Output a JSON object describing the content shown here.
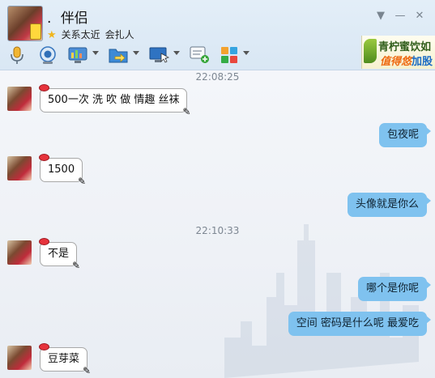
{
  "header": {
    "dot": ".",
    "nickname": "伴侣",
    "relation": "关系太近",
    "signature": "会扎人",
    "window_controls": {
      "menu": "▼",
      "minimize": "—",
      "close": "✕"
    },
    "toolbar_icons": [
      "microphone-icon",
      "video-camera-icon",
      "app-share-icon",
      "file-transfer-icon",
      "remote-screen-icon",
      "add-chat-icon",
      "apps-grid-icon"
    ],
    "ad": {
      "line1": "青柠蜜饮如",
      "line2_prefix": "值得悠",
      "line2_suffix": "加股"
    }
  },
  "colors": {
    "outgoing_bubble": "#7fc2ef",
    "incoming_bubble": "#ffffff",
    "header_bg": "#dde9f5"
  },
  "messages": [
    {
      "type": "time",
      "text": "22:08:25"
    },
    {
      "type": "in",
      "text": "500一次 洗 吹 做 情趣 丝袜"
    },
    {
      "type": "out",
      "text": "包夜呢"
    },
    {
      "type": "in",
      "text": "1500"
    },
    {
      "type": "out",
      "text": "头像就是你么"
    },
    {
      "type": "time",
      "text": "22:10:33"
    },
    {
      "type": "in",
      "text": "不是"
    },
    {
      "type": "out",
      "text": "哪个是你呢"
    },
    {
      "type": "out",
      "text": "空间 密码是什么呢 最爱吃"
    },
    {
      "type": "in",
      "text": "豆芽菜"
    }
  ]
}
